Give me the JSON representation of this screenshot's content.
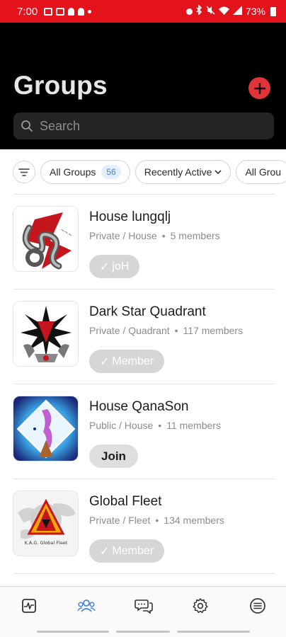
{
  "status_bar": {
    "time": "7:00",
    "battery": "73%",
    "background_color": "#e3121b"
  },
  "header": {
    "title": "Groups",
    "add_icon": "plus-circle-icon",
    "accent_color": "#e0343a"
  },
  "search": {
    "placeholder": "Search",
    "value": ""
  },
  "filters": {
    "filter_icon": "filter-lines-icon",
    "chips": [
      {
        "label": "All Groups",
        "count": "56"
      },
      {
        "label": "Recently Active",
        "has_chevron": true
      },
      {
        "label": "All Grou"
      }
    ]
  },
  "groups": [
    {
      "name": "House lungqlj",
      "type": "Private / House",
      "members": "5 members",
      "button": "joH",
      "button_state": "member",
      "avatar": "serpent-emblem"
    },
    {
      "name": "Dark Star Quadrant",
      "type": "Private / Quadrant",
      "members": "117 members",
      "button": "Member",
      "button_state": "member",
      "avatar": "dark-star-emblem"
    },
    {
      "name": "House QanaSon",
      "type": "Public / House",
      "members": "11 members",
      "button": "Join",
      "button_state": "join",
      "avatar": "crystal-emblem"
    },
    {
      "name": "Global Fleet",
      "type": "Private / Fleet",
      "members": "134 members",
      "button": "Member",
      "button_state": "member",
      "avatar": "fleet-emblem",
      "avatar_text": "K.A.G.   Global Fleet"
    }
  ],
  "bottom_nav": {
    "items": [
      {
        "icon": "activity-icon",
        "active": false
      },
      {
        "icon": "groups-icon",
        "active": true
      },
      {
        "icon": "chat-icon",
        "active": false
      },
      {
        "icon": "settings-icon",
        "active": false
      },
      {
        "icon": "menu-list-icon",
        "active": false
      }
    ],
    "active_color": "#4a86d8",
    "inactive_color": "#333333"
  }
}
